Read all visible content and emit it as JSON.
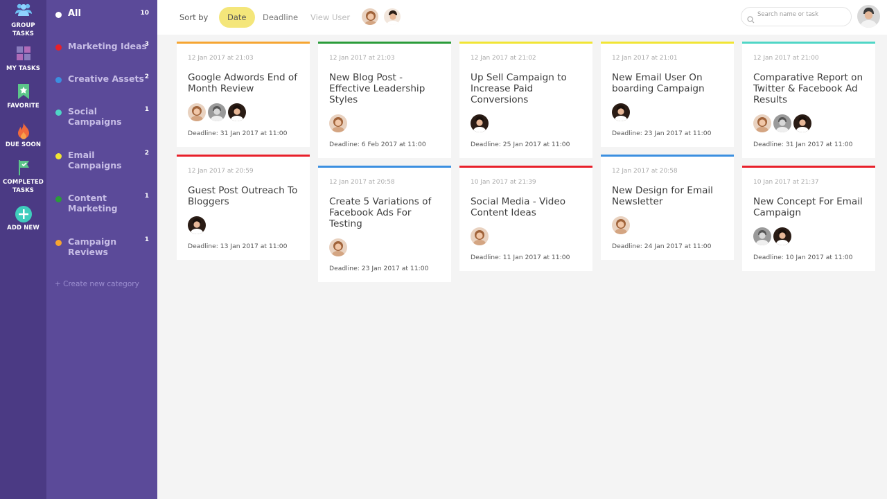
{
  "rail": {
    "items": [
      {
        "label_1": "GROUP",
        "label_2": "TASKS",
        "icon": "group-icon"
      },
      {
        "label_1": "MY TASKS",
        "icon": "grid-icon"
      },
      {
        "label_1": "FAVORITE",
        "icon": "bookmark-icon"
      },
      {
        "label_1": "DUE SOON",
        "icon": "flame-icon"
      },
      {
        "label_1": "COMPLETED",
        "label_2": "TASKS",
        "icon": "flag-icon"
      },
      {
        "label_1": "ADD NEW",
        "icon": "plus-circle-icon"
      }
    ]
  },
  "categories": {
    "items": [
      {
        "name": "All",
        "count": "10",
        "color": "#ffffff"
      },
      {
        "name": "Marketing Ideas",
        "count": "3",
        "color": "#e8202a"
      },
      {
        "name": "Creative Assets",
        "count": "2",
        "color": "#3b8fe0"
      },
      {
        "name": "Social Campaigns",
        "count": "1",
        "color": "#4fd6c6"
      },
      {
        "name": "Email Campaigns",
        "count": "2",
        "color": "#f1e534"
      },
      {
        "name": "Content Marketing",
        "count": "1",
        "color": "#2a9c3a"
      },
      {
        "name": "Campaign Reviews",
        "count": "1",
        "color": "#f6a531"
      }
    ],
    "create_label": "+ Create new category"
  },
  "topbar": {
    "sort_label": "Sort by",
    "sort_options": [
      "Date",
      "Deadline",
      "View User"
    ],
    "search_placeholder": "Search name or task"
  },
  "cards": [
    {
      "date": "12 Jan 2017 at 21:03",
      "title": "Google Adwords End of Month Review",
      "deadline": "Deadline: 31 Jan 2017 at 11:00",
      "color": "#f6a531",
      "members": [
        "woman",
        "gray",
        "man"
      ]
    },
    {
      "date": "12 Jan 2017 at 21:03",
      "title": "New Blog Post - Effective Leadership Styles",
      "deadline": "Deadline: 6 Feb 2017 at 11:00",
      "color": "#2a9c3a",
      "members": [
        "woman"
      ]
    },
    {
      "date": "12 Jan 2017 at 21:02",
      "title": "Up Sell Campaign to Increase Paid Conversions",
      "deadline": "Deadline: 25 Jan 2017 at 11:00",
      "color": "#f1e534",
      "members": [
        "man"
      ]
    },
    {
      "date": "12 Jan 2017 at 21:01",
      "title": "New Email User On boarding Campaign",
      "deadline": "Deadline: 23 Jan 2017 at 11:00",
      "color": "#f1e534",
      "members": [
        "man"
      ]
    },
    {
      "date": "12 Jan 2017 at 21:00",
      "title": "Comparative Report on Twitter & Facebook Ad Results",
      "deadline": "Deadline: 31 Jan 2017 at 11:00",
      "color": "#4fd6c6",
      "members": [
        "woman",
        "gray",
        "man"
      ]
    },
    {
      "date": "12 Jan 2017 at 20:59",
      "title": "Guest Post Outreach To Bloggers",
      "deadline": "Deadline: 13 Jan 2017 at 11:00",
      "color": "#e8202a",
      "members": [
        "man"
      ]
    },
    {
      "date": "12 Jan 2017 at 20:58",
      "title": "Create 5 Variations of Facebook Ads For Testing",
      "deadline": "Deadline: 23 Jan 2017 at 11:00",
      "color": "#3b8fe0",
      "members": [
        "woman"
      ]
    },
    {
      "date": "10 Jan 2017 at 21:39",
      "title": "Social Media - Video Content Ideas",
      "deadline": "Deadline: 11 Jan 2017 at 11:00",
      "color": "#e8202a",
      "members": [
        "woman"
      ]
    },
    {
      "date": "12 Jan 2017 at 20:58",
      "title": "New Design for Email Newsletter",
      "deadline": "Deadline: 24 Jan 2017 at 11:00",
      "color": "#3b8fe0",
      "members": [
        "woman"
      ]
    },
    {
      "date": "10 Jan 2017 at 21:37",
      "title": "New Concept For Email Campaign",
      "deadline": "Deadline: 10 Jan 2017 at 11:00",
      "color": "#e8202a",
      "members": [
        "gray",
        "man"
      ]
    }
  ]
}
